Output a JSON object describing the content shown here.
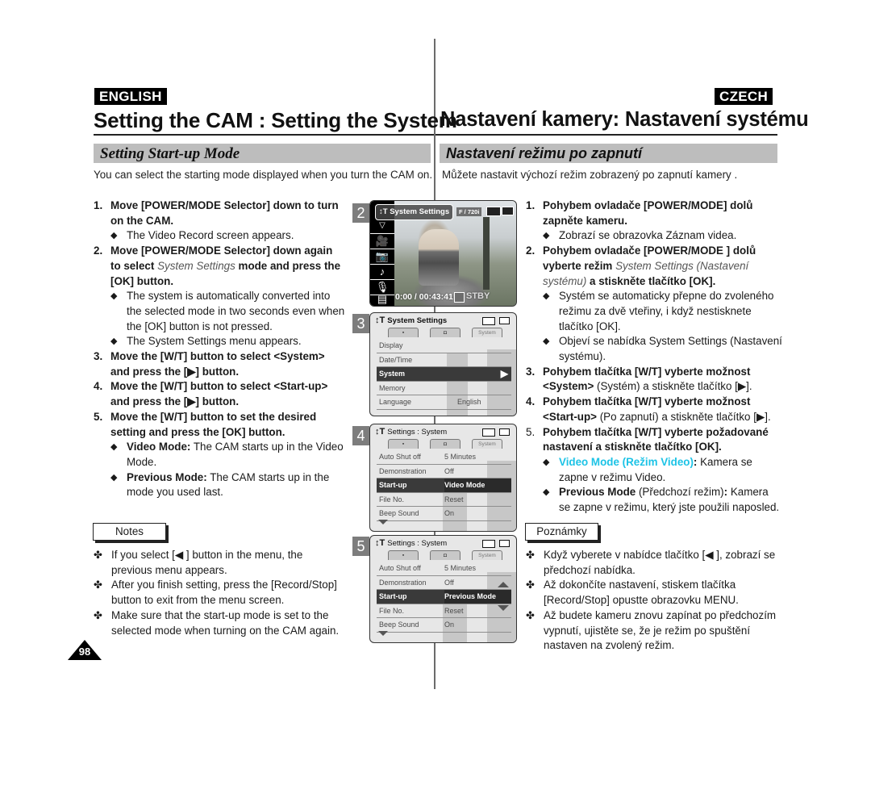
{
  "english": {
    "badge": "ENGLISH",
    "title": "Setting the CAM : Setting the System",
    "section": "Setting Start-up Mode",
    "intro": "You can select the starting mode displayed when you turn the CAM on.",
    "steps": [
      {
        "num": "1.",
        "text": "Move [POWER/MODE Selector] down to turn on the CAM.",
        "bullets": [
          "The Video Record screen appears."
        ]
      },
      {
        "num": "2.",
        "pre": "Move [POWER/MODE Selector] down again to select ",
        "em": "System Settings",
        "post": " mode and press the [OK] button.",
        "bullets": [
          "The system is automatically converted into the selected mode in two seconds even when the [OK] button is not pressed.",
          "The System Settings menu appears."
        ]
      },
      {
        "num": "3.",
        "text": "Move the [W/T] button to select <System> and press the [▶] button."
      },
      {
        "num": "4.",
        "text": "Move the [W/T] button to select <Start-up> and press the [▶] button."
      },
      {
        "num": "5.",
        "text": "Move the [W/T] button to set the desired setting and press the [OK] button.",
        "bullets": [
          {
            "label": "Video Mode:",
            "text": " The CAM starts up in the Video Mode."
          },
          {
            "label": "Previous Mode:",
            "text": " The CAM starts up in the mode you used last."
          }
        ]
      }
    ],
    "notes_label": "Notes",
    "notes": [
      "If you select [◀ ] button in the menu, the previous menu appears.",
      "After you finish setting, press the [Record/Stop] button to exit from the menu screen.",
      "Make sure that the start-up mode is set to the selected mode when turning on the CAM again."
    ],
    "page_number": "98"
  },
  "czech": {
    "badge": "CZECH",
    "title": "Nastavení kamery: Nastavení systému",
    "section": "Nastavení režimu po zapnutí",
    "intro": "Můžete nastavit výchozí režim zobrazený po zapnutí kamery .",
    "steps": [
      {
        "num": "1.",
        "text": "Pohybem ovladače [POWER/MODE] dolů zapněte kameru.",
        "bullets": [
          "Zobrazí se obrazovka Záznam videa."
        ]
      },
      {
        "num": "2.",
        "pre": "Pohybem ovladače [POWER/MODE ] dolů vyberte režim ",
        "em": "System Settings (Nastavení systému)",
        "post": " a stiskněte tlačítko [OK].",
        "bullets": [
          "Systém se automaticky přepne do zvoleného režimu za dvě vteřiny, i když nestisknete tlačítko [OK].",
          "Objeví se nabídka System Settings (Nastavení systému)."
        ]
      },
      {
        "num": "3.",
        "bold": "Pohybem tlačítka [W/T] vyberte možnost",
        "b2": "<System>",
        "rest": " (Systém) a stiskněte tlačítko [▶]."
      },
      {
        "num": "4.",
        "bold": "Pohybem tlačítka [W/T] vyberte možnost",
        "b2": "<Start-up>",
        "rest": " (Po zapnutí) a stiskněte tlačítko [▶]."
      },
      {
        "num": "5.",
        "text": "Pohybem tlačítka [W/T] vyberte požadované nastavení a stiskněte tlačítko [OK].",
        "bullets": [
          {
            "label": "Video Mode (Režim Video)",
            "sep": ":",
            "text": " Kamera se zapne v režimu Video."
          },
          {
            "label": "Previous Mode",
            "mid": " (Předchozí režim)",
            "sep": ":",
            "text": " Kamera se zapne v režimu, který jste použili naposled."
          }
        ]
      }
    ],
    "notes_label": "Poznámky",
    "notes": [
      "Když vyberete v nabídce tlačítko [◀ ], zobrazí se předchozí nabídka.",
      "Až dokončíte nastavení, stiskem tlačítka [Record/Stop] opustte obrazovku MENU.",
      "Až budete kameru znovu zapínat po předchozím vypnutí, ujistěte se, že je režim po spuštění nastaven na zvolený režim."
    ]
  },
  "screens": {
    "s2": {
      "step": "2",
      "mode_label": "System Settings",
      "resolution": "F / 720i",
      "timecode": "0:00 / 00:43:41",
      "status": "STBY",
      "side_icons": [
        "menu-down-icon",
        "video-camera-icon",
        "photo-camera-icon",
        "music-icon",
        "voice-icon",
        "file-icon"
      ]
    },
    "s3": {
      "step": "3",
      "title": "System Settings",
      "tabs": [
        "🎥",
        "📷",
        "System"
      ],
      "rows": [
        {
          "k": "Display",
          "v": ""
        },
        {
          "k": "Date/Time",
          "v": ""
        },
        {
          "k": "System",
          "v": "",
          "selected": true
        },
        {
          "k": "Memory",
          "v": ""
        },
        {
          "k": "Language",
          "v": "English"
        }
      ]
    },
    "s4": {
      "step": "4",
      "title": "Settings : System",
      "tabs": [
        "🎥",
        "📷",
        "System"
      ],
      "rows": [
        {
          "k": "Auto Shut off",
          "v": "5 Minutes"
        },
        {
          "k": "Demonstration",
          "v": "Off"
        },
        {
          "k": "Start-up",
          "v": "Video Mode",
          "selected": true
        },
        {
          "k": "File No.",
          "v": "Reset"
        },
        {
          "k": "Beep Sound",
          "v": "On"
        }
      ]
    },
    "s5": {
      "step": "5",
      "title": "Settings : System",
      "tabs": [
        "🎥",
        "📷",
        "System"
      ],
      "rows": [
        {
          "k": "Auto Shut off",
          "v": "5 Minutes"
        },
        {
          "k": "Demonstration",
          "v": "Off"
        },
        {
          "k": "Start-up",
          "v": "Previous Mode",
          "selected": true
        },
        {
          "k": "File No.",
          "v": "Reset"
        },
        {
          "k": "Beep Sound",
          "v": "On"
        }
      ]
    }
  },
  "colors": {
    "highlight_cyan": "#1cc3e6",
    "section_bar": "#bdbdbd",
    "step_tag": "#7d7d7d"
  }
}
